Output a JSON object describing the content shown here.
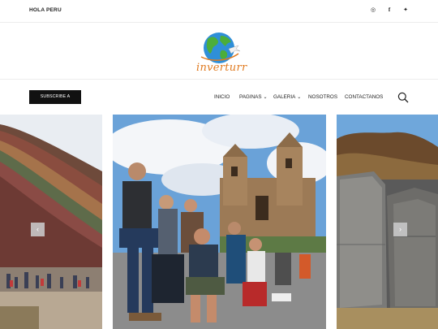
{
  "topbar": {
    "greeting": "HOLA PERU",
    "social": [
      {
        "icon": "instagram-icon",
        "glyph": "◎"
      },
      {
        "icon": "facebook-icon",
        "glyph": "f"
      },
      {
        "icon": "twitter-icon",
        "glyph": "✦"
      }
    ]
  },
  "brand": {
    "name": "inverturr",
    "accent": "#e07a1f"
  },
  "nav": {
    "subscribe_label": "SUBSCRIBE A INVERTURR",
    "items": [
      {
        "label": "INICIO",
        "has_dropdown": false
      },
      {
        "label": "PAGINAS",
        "has_dropdown": true
      },
      {
        "label": "GALERIA",
        "has_dropdown": true
      },
      {
        "label": "NOSOTROS",
        "has_dropdown": false
      },
      {
        "label": "CONTACTANOS",
        "has_dropdown": false
      }
    ],
    "search_icon": "search-icon"
  },
  "slider": {
    "prev_glyph": "‹",
    "next_glyph": "›"
  }
}
